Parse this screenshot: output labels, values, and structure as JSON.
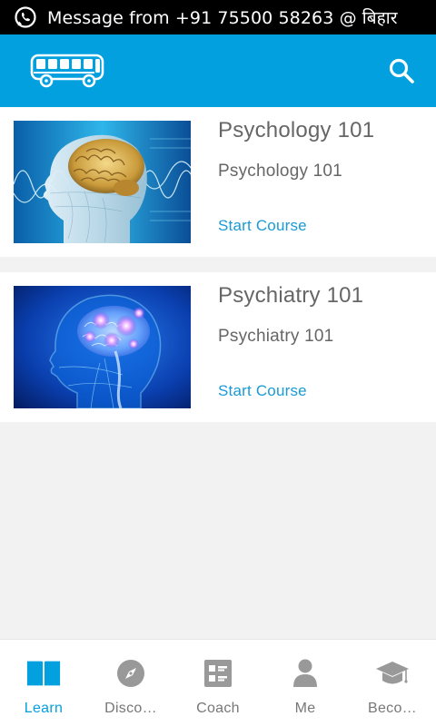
{
  "status_bar": {
    "notification_icon": "whatsapp-icon",
    "message": "Message from +91 75500 58263 @ बिहार"
  },
  "app_bar": {
    "logo_icon": "bus-icon",
    "search_icon": "search-icon",
    "color": "#03a0df"
  },
  "courses": [
    {
      "title": "Psychology 101",
      "subtitle": "Psychology 101",
      "action": "Start Course",
      "image": "brain-head-profile-image"
    },
    {
      "title": "Psychiatry 101",
      "subtitle": "Psychiatry 101",
      "action": "Start Course",
      "image": "glowing-brain-head-image"
    }
  ],
  "bottom_nav": {
    "active": "Learn",
    "active_color": "#03a0df",
    "items": [
      {
        "label": "Learn",
        "icon": "book-icon"
      },
      {
        "label": "Disco…",
        "icon": "compass-icon"
      },
      {
        "label": "Coach",
        "icon": "checklist-icon"
      },
      {
        "label": "Me",
        "icon": "person-icon"
      },
      {
        "label": "Beco…",
        "icon": "graduation-cap-icon"
      }
    ]
  }
}
